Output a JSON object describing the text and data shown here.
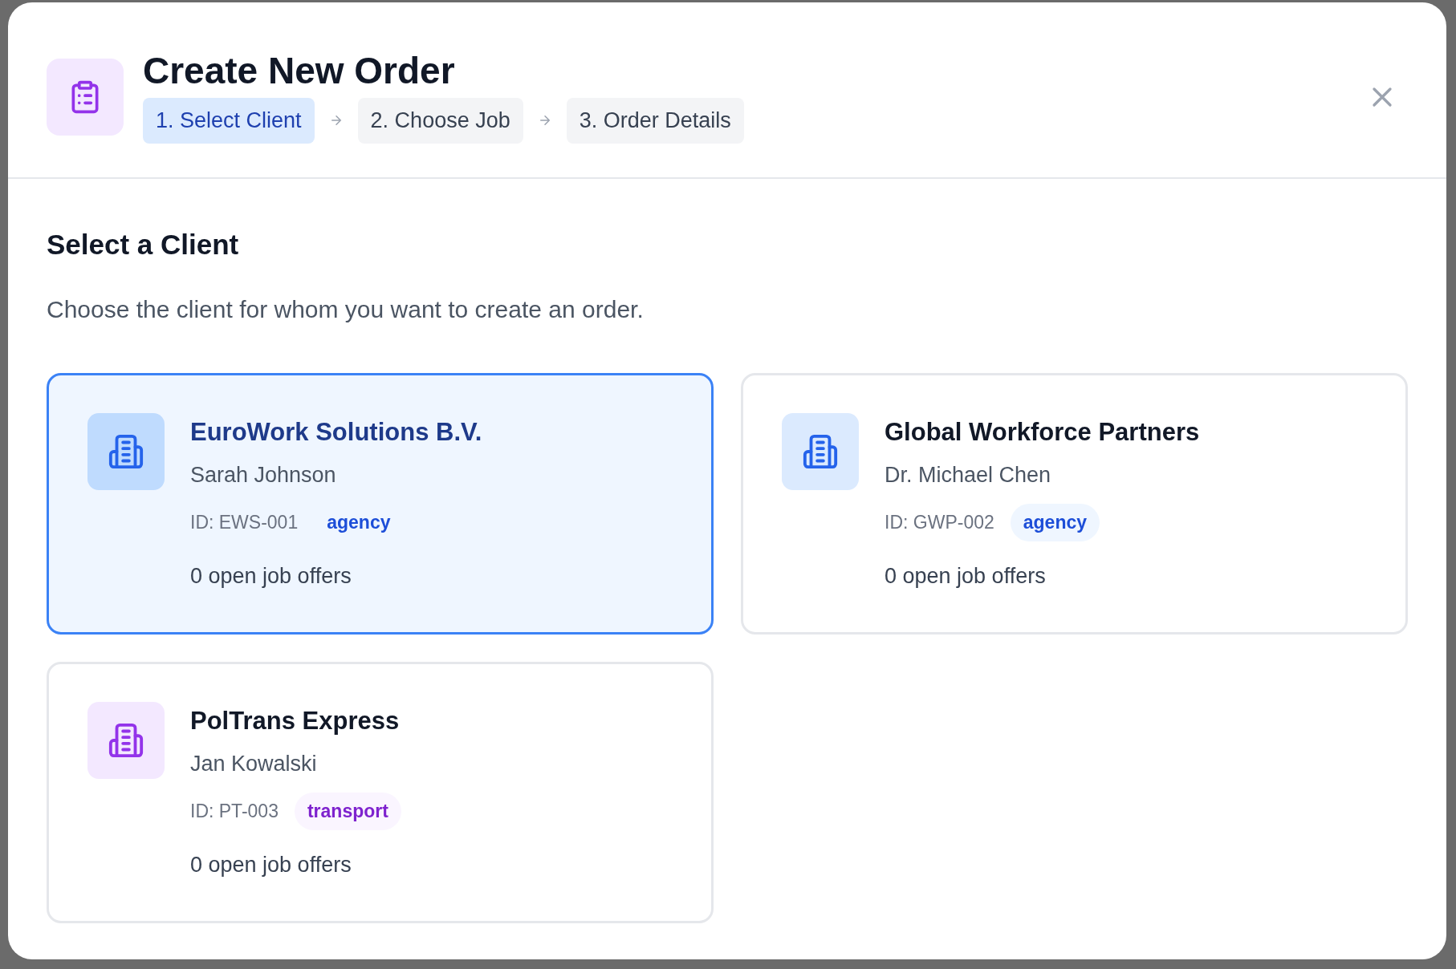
{
  "dialog": {
    "title": "Create New Order",
    "steps": [
      {
        "label": "1. Select Client",
        "selected": true
      },
      {
        "label": "2. Choose Job",
        "selected": false
      },
      {
        "label": "3. Order Details",
        "selected": false
      }
    ]
  },
  "section": {
    "heading": "Select a Client",
    "description": "Choose the client for whom you want to create an order."
  },
  "clients": [
    {
      "name": "EuroWork Solutions B.V.",
      "contact": "Sarah Johnson",
      "id": "ID: EWS-001",
      "kind": "agency",
      "tag": "agency",
      "offers": "0 open job offers",
      "selected": true
    },
    {
      "name": "Global Workforce Partners",
      "contact": "Dr. Michael Chen",
      "id": "ID: GWP-002",
      "kind": "agency",
      "tag": "agency",
      "offers": "0 open job offers",
      "selected": false
    },
    {
      "name": "PolTrans Express",
      "contact": "Jan Kowalski",
      "id": "ID: PT-003",
      "kind": "transport",
      "tag": "transport",
      "offers": "0 open job offers",
      "selected": false
    }
  ]
}
